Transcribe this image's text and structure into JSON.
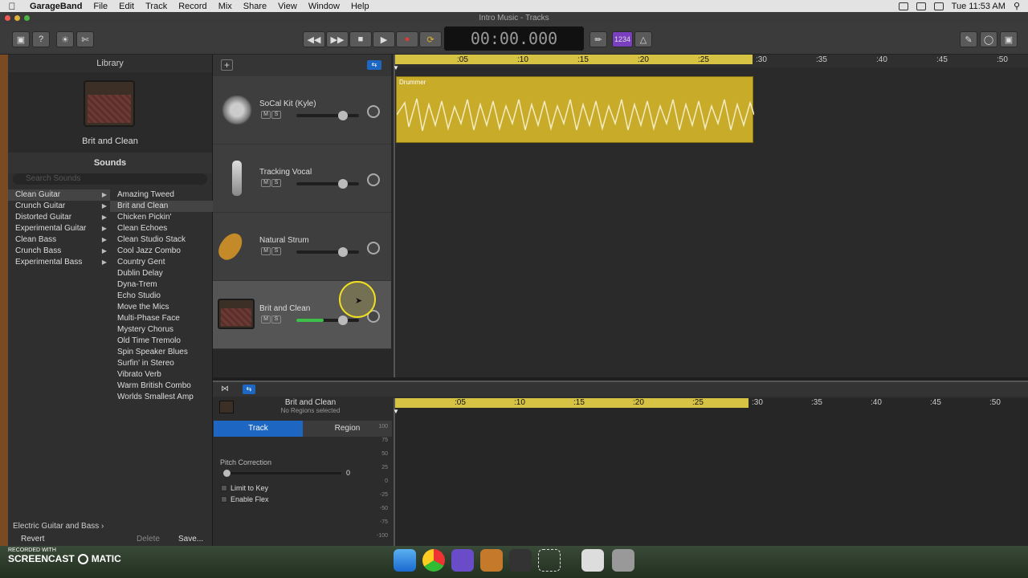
{
  "menubar": {
    "app": "GarageBand",
    "items": [
      "File",
      "Edit",
      "Track",
      "Record",
      "Mix",
      "Share",
      "View",
      "Window",
      "Help"
    ],
    "clock": "Tue 11:53 AM"
  },
  "window": {
    "title": "Intro Music - Tracks"
  },
  "transport": {
    "time": "00:00.000",
    "count_in": "1234"
  },
  "library": {
    "heading": "Library",
    "preset": "Brit and Clean",
    "sounds_label": "Sounds",
    "search_placeholder": "Search Sounds",
    "categories": [
      "Clean Guitar",
      "Crunch Guitar",
      "Distorted Guitar",
      "Experimental Guitar",
      "Clean Bass",
      "Crunch Bass",
      "Experimental Bass"
    ],
    "sounds": [
      "Amazing Tweed",
      "Brit and Clean",
      "Chicken Pickin'",
      "Clean Echoes",
      "Clean Studio Stack",
      "Cool Jazz Combo",
      "Country Gent",
      "Dublin Delay",
      "Dyna-Trem",
      "Echo Studio",
      "Move the Mics",
      "Multi-Phase Face",
      "Mystery Chorus",
      "Old Time Tremolo",
      "Spin Speaker Blues",
      "Surfin' in Stereo",
      "Vibrato Verb",
      "Warm British Combo",
      "Worlds Smallest Amp"
    ],
    "breadcrumb": "Electric Guitar and Bass",
    "revert": "Revert",
    "delete": "Delete",
    "save": "Save..."
  },
  "tracks": [
    {
      "name": "SoCal Kit (Kyle)"
    },
    {
      "name": "Tracking Vocal"
    },
    {
      "name": "Natural Strum"
    },
    {
      "name": "Brit and Clean",
      "volume_percent": 72
    }
  ],
  "ruler": {
    "labels": [
      ":05",
      ":10",
      ":15",
      ":20",
      ":25",
      ":30",
      ":35",
      ":40",
      ":45",
      ":50"
    ]
  },
  "region": {
    "name": "Drummer"
  },
  "editor": {
    "track_name": "Brit and Clean",
    "subtitle": "No Regions selected",
    "tab_track": "Track",
    "tab_region": "Region",
    "pitch_label": "Pitch Correction",
    "pitch_value": "0",
    "limit_key": "Limit to Key",
    "enable_flex": "Enable Flex",
    "db_scale": [
      "100",
      "75",
      "50",
      "25",
      "0",
      "-25",
      "-50",
      "-75",
      "-100"
    ]
  },
  "watermark": {
    "line1": "RECORDED WITH",
    "line2": "SCREENCAST",
    "line3": "MATIC"
  }
}
